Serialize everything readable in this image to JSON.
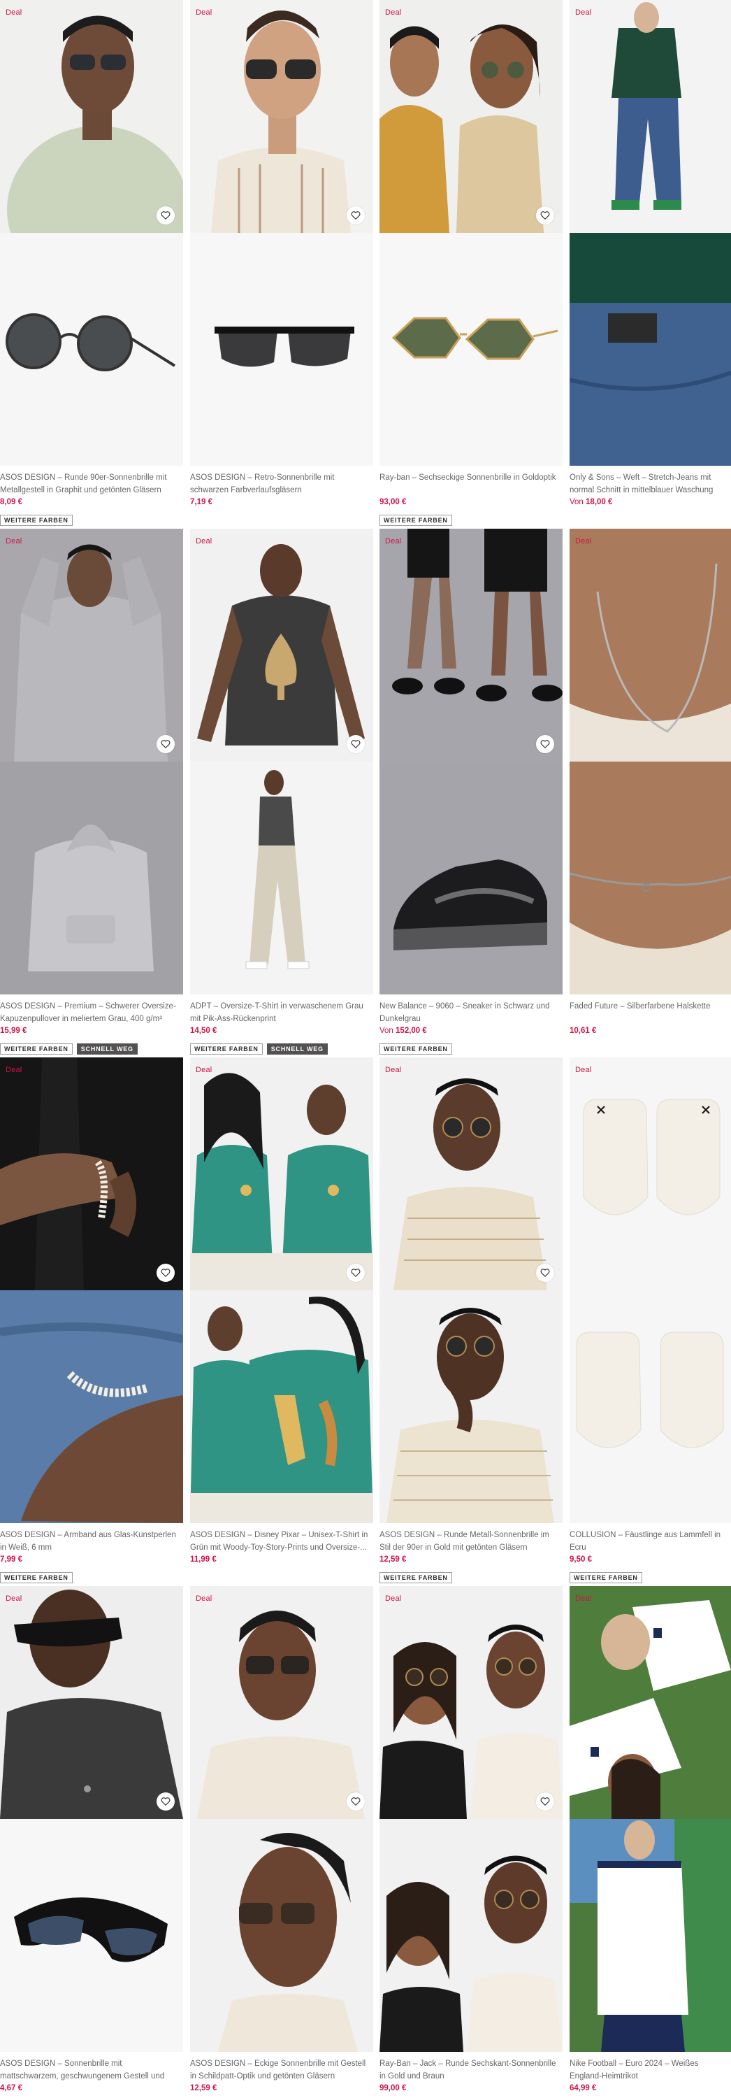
{
  "deal_label": "Deal",
  "colors": {
    "price": "#d01345",
    "deal": "#d01345",
    "text": "#666666"
  },
  "products": [
    {
      "title": "ASOS DESIGN – Runde 90er-Sonnenbrille mit Metallgestell in Graphit und getönten Gläsern",
      "price": "8,09 €",
      "chips": [
        "WEITERE FARBEN"
      ]
    },
    {
      "title": "ASOS DESIGN – Retro-Sonnenbrille mit schwarzen Farbverlaufsgläsern",
      "price": "7,19 €",
      "chips": []
    },
    {
      "title": "Ray-ban – Sechseckige Sonnenbrille in Goldoptik",
      "price": "93,00 €",
      "chips": [
        "WEITERE FARBEN"
      ]
    },
    {
      "title": "Only & Sons – Weft – Stretch-Jeans mit normal Schnitt in mittelblauer Waschung",
      "price_prefix": "Von",
      "price": "18,00 €",
      "chips": []
    },
    {
      "title": "ASOS DESIGN – Premium – Schwerer Oversize-Kapuzenpullover in meliertem Grau, 400 g/m²",
      "price": "15,99 €",
      "chips": [
        "WEITERE FARBEN",
        "SCHNELL WEG"
      ]
    },
    {
      "title": "ADPT – Oversize-T-Shirt in verwaschenem Grau mit Pik-Ass-Rückenprint",
      "price": "14,50 €",
      "chips": [
        "WEITERE FARBEN",
        "SCHNELL WEG"
      ]
    },
    {
      "title": "New Balance – 9060 – Sneaker in Schwarz und Dunkelgrau",
      "price_prefix": "Von",
      "price": "152,00 €",
      "chips": [
        "WEITERE FARBEN"
      ]
    },
    {
      "title": "Faded Future – Silberfarbene Halskette",
      "price": "10,61 €",
      "chips": []
    },
    {
      "title": "ASOS DESIGN – Armband aus Glas-Kunstperlen in Weiß, 6 mm",
      "price": "7,99 €",
      "chips": [
        "WEITERE FARBEN"
      ]
    },
    {
      "title": "ASOS DESIGN – Disney Pixar – Unisex-T-Shirt in Grün mit Woody-Toy-Story-Prints und Oversize-...",
      "price": "11,99 €",
      "chips": []
    },
    {
      "title": "ASOS DESIGN – Runde Metall-Sonnenbrille im Stil der 90er in Gold mit getönten Gläsern",
      "price": "12,59 €",
      "chips": [
        "WEITERE FARBEN"
      ]
    },
    {
      "title": "COLLUSION – Fäustlinge aus Lammfell in Ecru",
      "price": "9,50 €",
      "chips": [
        "WEITERE FARBEN"
      ]
    },
    {
      "title": "ASOS DESIGN – Sonnenbrille mit mattschwarzem, geschwungenem Gestell und getönten Gläsern",
      "price": "4,67 €",
      "chips": []
    },
    {
      "title": "ASOS DESIGN – Eckige Sonnenbrille mit Gestell in Schildpatt-Optik und getönten Gläsern",
      "price": "12,59 €",
      "chips": []
    },
    {
      "title": "Ray-Ban – Jack – Runde Sechskant-Sonnenbrille in Gold und Braun",
      "price": "99,00 €",
      "chips": []
    },
    {
      "title": "Nike Football – Euro 2024 – Weißes England-Heimtrikot",
      "price": "64,99 €",
      "chips": []
    }
  ]
}
